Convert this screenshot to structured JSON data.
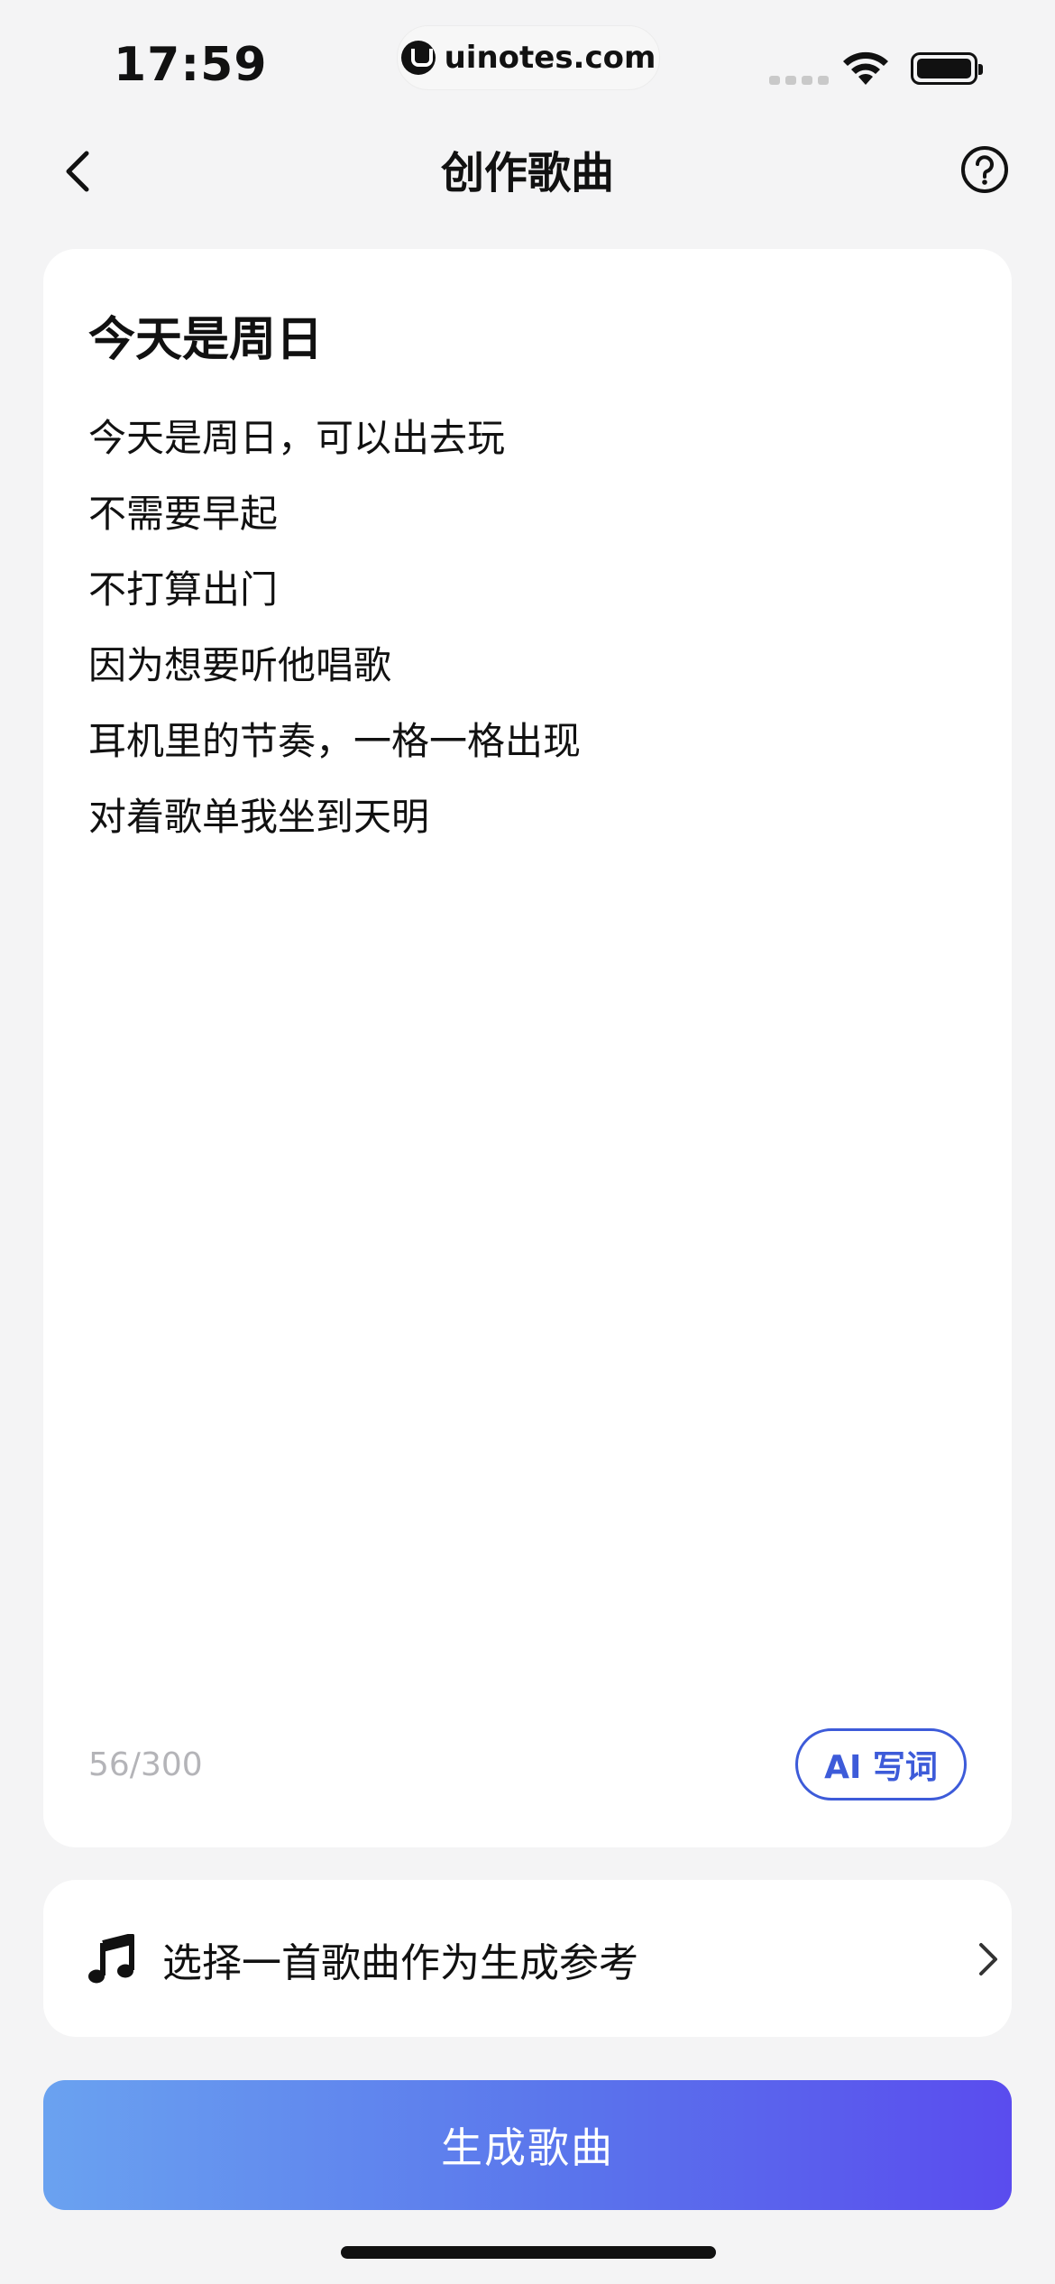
{
  "status_bar": {
    "time": "17:59",
    "url": "uinotes.com",
    "icons": [
      "signal-icon",
      "wifi-icon",
      "battery-icon"
    ]
  },
  "nav": {
    "title": "创作歌曲",
    "back_icon": "chevron-left-icon",
    "help_icon": "question-circle-icon"
  },
  "lyrics_card": {
    "song_title": "今天是周日",
    "lines": [
      "今天是周日，可以出去玩",
      "不需要早起",
      "不打算出门",
      "因为想要听他唱歌",
      "耳机里的节奏，一格一格出现",
      "对着歌单我坐到天明"
    ],
    "char_count": "56/300",
    "ai_button_label": "AI 写词"
  },
  "reference": {
    "icon": "music-note-icon",
    "label": "选择一首歌曲作为生成参考",
    "chevron_icon": "chevron-right-icon"
  },
  "generate_button_label": "生成歌曲",
  "colors": {
    "background": "#f4f4f5",
    "accent_blue": "#3d5bd9",
    "gradient_start": "#6aa2f0",
    "gradient_end": "#5a4cee",
    "muted_text": "#b4b4b8"
  }
}
